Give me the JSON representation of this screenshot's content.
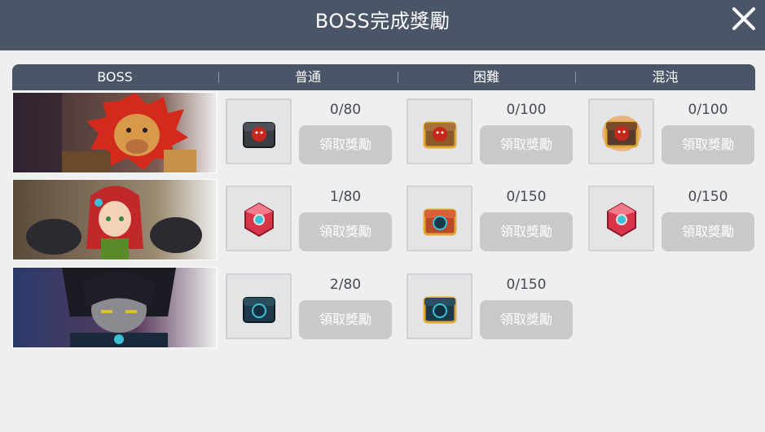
{
  "window": {
    "title": "BOSS完成獎勵"
  },
  "table": {
    "headers": {
      "boss": "BOSS",
      "normal": "普通",
      "hard": "困難",
      "chaos": "混沌"
    }
  },
  "rows": [
    {
      "boss_icon": "lion-king-portrait",
      "normal": {
        "count": "0/80",
        "button": "領取獎勵",
        "icon": "dark-chest-red-face-icon"
      },
      "hard": {
        "count": "0/100",
        "button": "領取獎勵",
        "icon": "gold-chest-red-face-icon"
      },
      "chaos": {
        "count": "0/100",
        "button": "領取獎勵",
        "icon": "flaming-chest-red-face-icon"
      }
    },
    {
      "boss_icon": "red-haired-queen-portrait",
      "normal": {
        "count": "1/80",
        "button": "領取獎勵",
        "icon": "red-gem-icon"
      },
      "hard": {
        "count": "0/150",
        "button": "領取獎勵",
        "icon": "teal-gold-chest-icon"
      },
      "chaos": {
        "count": "0/150",
        "button": "領取獎勵",
        "icon": "red-gem-icon"
      }
    },
    {
      "boss_icon": "dark-lord-portrait",
      "normal": {
        "count": "2/80",
        "button": "領取獎勵",
        "icon": "dark-teal-chest-icon"
      },
      "hard": {
        "count": "0/150",
        "button": "領取獎勵",
        "icon": "gold-teal-chest-icon"
      }
    }
  ],
  "colors": {
    "header_bg": "#4a5568",
    "button_disabled": "#c9c9c9",
    "page_bg": "#efefef"
  }
}
